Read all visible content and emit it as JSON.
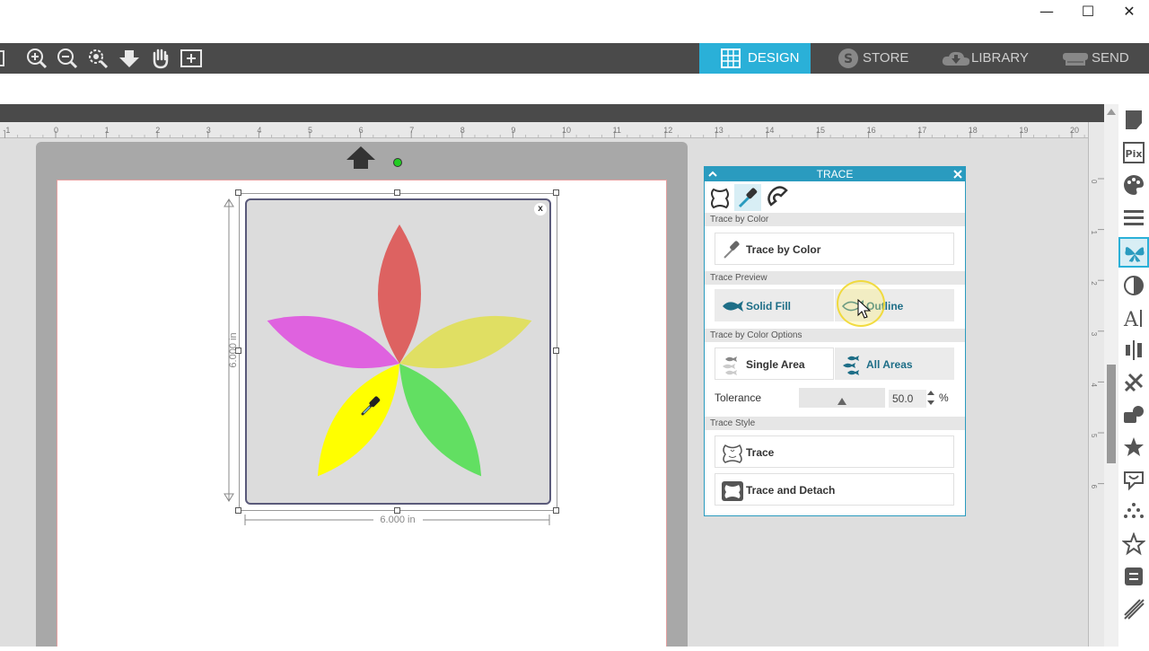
{
  "window": {
    "minimize": "—",
    "maximize": "☐",
    "close": "✕"
  },
  "toolbar": {
    "tools": [
      "zoom-in",
      "zoom-out",
      "zoom-fit",
      "move-down",
      "pan",
      "add-page"
    ],
    "tabs": [
      {
        "label": "DESIGN",
        "icon": "grid-icon",
        "active": true
      },
      {
        "label": "STORE",
        "icon": "store-s-icon",
        "active": false
      },
      {
        "label": "LIBRARY",
        "icon": "cloud-icon",
        "active": false
      },
      {
        "label": "SEND",
        "icon": "cutter-icon",
        "active": false
      }
    ]
  },
  "ruler": {
    "ticks": [
      "-1",
      "0",
      "1",
      "2",
      "3",
      "4",
      "5",
      "6",
      "7",
      "8",
      "9",
      "10",
      "11",
      "12",
      "13",
      "14",
      "15",
      "16",
      "17",
      "18",
      "19",
      "20"
    ]
  },
  "vruler": {
    "ticks": [
      "0",
      "1",
      "2",
      "3",
      "4",
      "5",
      "6"
    ]
  },
  "canvas": {
    "height_label": "6.000 in",
    "width_label": "6.000 in",
    "close_glyph": "x",
    "petal_colors": [
      "#dd6261",
      "#df62df",
      "#e0df63",
      "#ffff00",
      "#62df62"
    ]
  },
  "trace": {
    "title": "TRACE",
    "collapse_glyph": "^",
    "close_glyph": "✕",
    "sections": {
      "by_color": "Trace by Color",
      "preview": "Trace Preview",
      "options": "Trace by Color Options",
      "style": "Trace Style"
    },
    "trace_by_color_button": "Trace by Color",
    "solid_fill": "Solid Fill",
    "outline": "Outline",
    "single_area": "Single Area",
    "all_areas": "All Areas",
    "tolerance_label": "Tolerance",
    "tolerance_value": "50.0",
    "tolerance_unit": "%",
    "tolerance_fraction": 0.5,
    "trace_button": "Trace",
    "trace_detach_button": "Trace and Detach"
  },
  "accent": "#2ab0d8"
}
